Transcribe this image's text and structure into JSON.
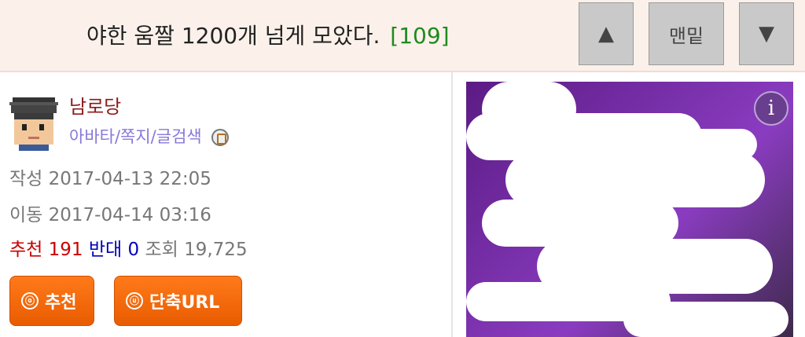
{
  "post": {
    "title": "야한 움짤 1200개 넘게 모았다.",
    "comment_count": "[109]"
  },
  "nav": {
    "up_label": "▲",
    "bottom_label": "맨밑",
    "down_label": "▼"
  },
  "author": {
    "name": "남로당",
    "links": "아바타/쪽지/글검색"
  },
  "meta": {
    "written_label": "작성",
    "written_value": "2017-04-13 22:05",
    "moved_label": "이동",
    "moved_value": "2017-04-14 03:16",
    "recommend_label": "추천",
    "recommend_value": "191",
    "oppose_label": "반대",
    "oppose_value": "0",
    "views_label": "조회",
    "views_value": "19,725"
  },
  "actions": {
    "recommend_icon": "ⓞ",
    "recommend_label": "추천",
    "url_icon": "ⓤ",
    "url_label": "단축URL"
  },
  "ad": {
    "info_icon": "i"
  }
}
